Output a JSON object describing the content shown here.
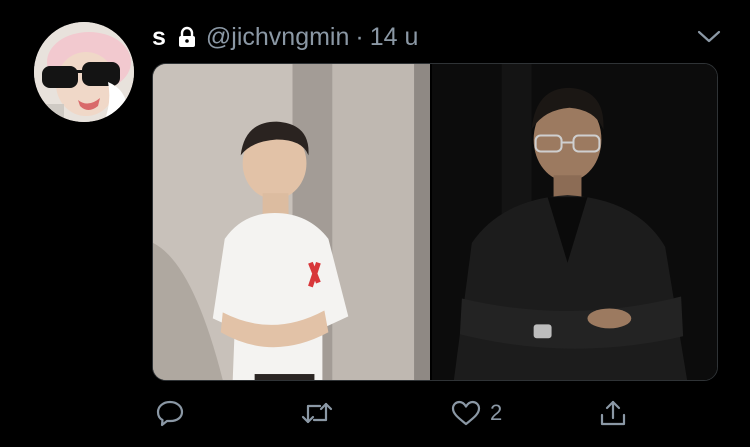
{
  "tweet": {
    "display_name": "s",
    "handle": "@jichvngmin",
    "separator": "·",
    "time": "14 u",
    "protected_icon": "lock-icon",
    "menu_icon": "chevron-down-icon",
    "avatar_alt": "profile photo",
    "media": [
      {
        "alt": "young man in white t-shirt with arms crossed"
      },
      {
        "alt": "man in black suit with glasses, arms crossed"
      }
    ],
    "actions": {
      "reply_icon": "reply-icon",
      "retweet_icon": "retweet-icon",
      "like_icon": "heart-icon",
      "like_count": "2",
      "share_icon": "share-icon"
    }
  },
  "colors": {
    "background": "#000000",
    "text": "#ffffff",
    "secondary_text": "#8b98a5"
  }
}
